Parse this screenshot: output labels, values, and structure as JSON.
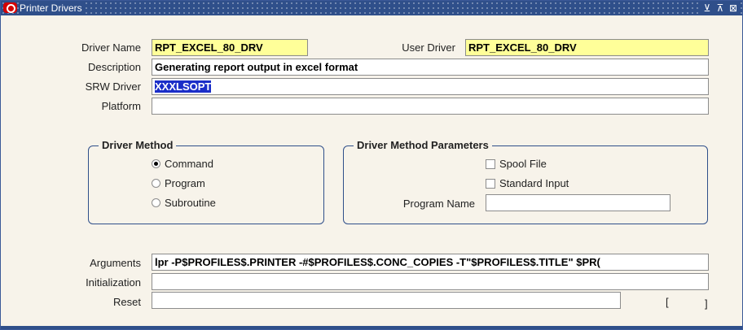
{
  "window": {
    "title": "Printer Drivers",
    "controls": [
      "⊻",
      "⊼",
      "⊠"
    ]
  },
  "form": {
    "driver_name": {
      "label": "Driver Name",
      "value": "RPT_EXCEL_80_DRV"
    },
    "user_driver": {
      "label": "User Driver",
      "value": "RPT_EXCEL_80_DRV"
    },
    "description": {
      "label": "Description",
      "value": "Generating report output in excel format"
    },
    "srw_driver": {
      "label": "SRW Driver",
      "value": "XXXLSOPT"
    },
    "platform": {
      "label": "Platform",
      "value": ""
    },
    "arguments": {
      "label": "Arguments",
      "value": "lpr -P$PROFILES$.PRINTER -#$PROFILES$.CONC_COPIES -T\"$PROFILES$.TITLE\" $PR("
    },
    "initialization": {
      "label": "Initialization",
      "value": ""
    },
    "reset": {
      "label": "Reset",
      "value": ""
    },
    "bracket_open": "[",
    "bracket_close": "]"
  },
  "driver_method": {
    "title": "Driver Method",
    "options": [
      {
        "label": "Command",
        "selected": true
      },
      {
        "label": "Program",
        "selected": false
      },
      {
        "label": "Subroutine",
        "selected": false
      }
    ]
  },
  "driver_method_parameters": {
    "title": "Driver Method Parameters",
    "spool_file": {
      "label": "Spool File",
      "checked": false
    },
    "standard_input": {
      "label": "Standard Input",
      "checked": false
    },
    "program_name": {
      "label": "Program Name",
      "value": ""
    }
  },
  "colors": {
    "title_bar": "#2f4f8a",
    "required_field": "#ffff99",
    "selection": "#1b2ec8",
    "background": "#f7f3ea"
  }
}
